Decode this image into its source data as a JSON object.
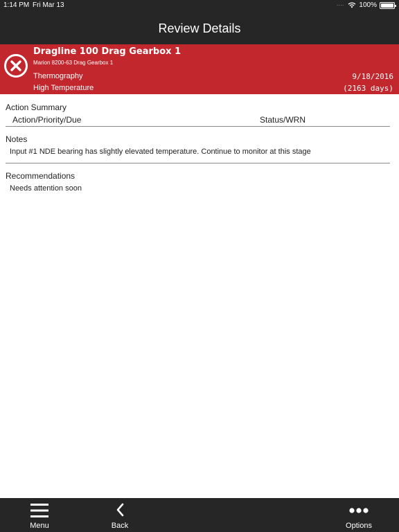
{
  "status": {
    "time": "1:14 PM",
    "date": "Fri Mar 13",
    "battery": "100%"
  },
  "nav": {
    "title": "Review Details"
  },
  "asset": {
    "name": "Dragline 100 Drag Gearbox 1",
    "subtitle": "Marion 8200-63 Drag Gearbox 1",
    "technology": "Thermography",
    "fault": "High Temperature",
    "date": "9/18/2016",
    "days": "(2163 days)",
    "severity_color": "#c1272d"
  },
  "action_summary": {
    "title": "Action Summary",
    "col_left": "Action/Priority/Due",
    "col_right": "Status/WRN"
  },
  "notes": {
    "title": "Notes",
    "text": "Input #1 NDE bearing has slightly elevated temperature. Continue to monitor at this stage"
  },
  "recommendations": {
    "title": "Recommendations",
    "text": "Needs attention soon"
  },
  "tabs": {
    "menu": {
      "label": "Menu",
      "icon": "hamburger-icon"
    },
    "back": {
      "label": "Back",
      "icon": "chevron-left-icon"
    },
    "options": {
      "label": "Options",
      "icon": "more-dots-icon"
    }
  }
}
